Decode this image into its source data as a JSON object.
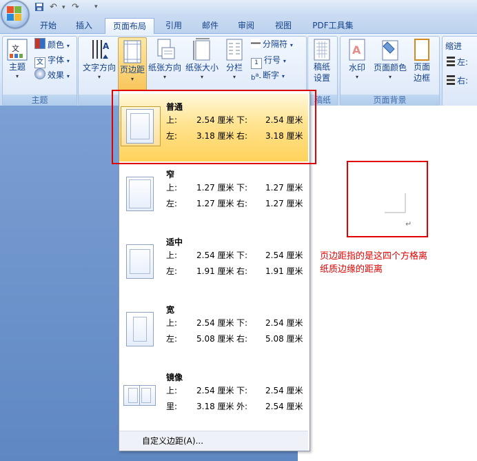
{
  "window": {
    "tabs": [
      {
        "label": "开始"
      },
      {
        "label": "插入"
      },
      {
        "label": "页面布局"
      },
      {
        "label": "引用"
      },
      {
        "label": "邮件"
      },
      {
        "label": "审阅"
      },
      {
        "label": "视图"
      },
      {
        "label": "PDF工具集"
      }
    ],
    "active_tab": "页面布局"
  },
  "ribbon": {
    "theme_group": {
      "label": "主题",
      "themes_button": "主题",
      "colors": "颜色",
      "fonts": "字体",
      "effects": "效果"
    },
    "page_setup_group": {
      "text_direction": "文字方向",
      "margins": "页边距",
      "orientation": "纸张方向",
      "size": "纸张大小",
      "columns": "分栏",
      "breaks": "分隔符",
      "line_numbers": "行号",
      "hyphenation": "断字"
    },
    "manuscript_group": {
      "label": "稿纸",
      "button": "稿纸设置"
    },
    "background_group": {
      "label": "页面背景",
      "watermark": "水印",
      "page_color": "页面颜色",
      "page_borders": "页面边框"
    },
    "paragraph_group": {
      "indent_title": "缩进",
      "left": "左:",
      "right": "右:"
    }
  },
  "margins_menu": {
    "presets": [
      {
        "name": "普通",
        "label1": "上:",
        "value1": "2.54 厘米",
        "label2": "下:",
        "value2": "2.54 厘米",
        "label3": "左:",
        "value3": "3.18 厘米",
        "label4": "右:",
        "value4": "3.18 厘米"
      },
      {
        "name": "窄",
        "label1": "上:",
        "value1": "1.27 厘米",
        "label2": "下:",
        "value2": "1.27 厘米",
        "label3": "左:",
        "value3": "1.27 厘米",
        "label4": "右:",
        "value4": "1.27 厘米"
      },
      {
        "name": "适中",
        "label1": "上:",
        "value1": "2.54 厘米",
        "label2": "下:",
        "value2": "2.54 厘米",
        "label3": "左:",
        "value3": "1.91 厘米",
        "label4": "右:",
        "value4": "1.91 厘米"
      },
      {
        "name": "宽",
        "label1": "上:",
        "value1": "2.54 厘米",
        "label2": "下:",
        "value2": "2.54 厘米",
        "label3": "左:",
        "value3": "5.08 厘米",
        "label4": "右:",
        "value4": "5.08 厘米"
      },
      {
        "name": "镜像",
        "label1": "上:",
        "value1": "2.54 厘米",
        "label2": "下:",
        "value2": "2.54 厘米",
        "label3": "里:",
        "value3": "3.18 厘米",
        "label4": "外:",
        "value4": "2.54 厘米"
      }
    ],
    "selected": "普通",
    "custom": "自定义边距(A)..."
  },
  "annotation": {
    "text_line1": "页边距指的是这四个方格离",
    "text_line2": "纸质边缘的距离",
    "paragraph_mark": "↵",
    "color": "#e00000"
  },
  "colors": {
    "ribbon": "#dbe8f8",
    "highlight": "#ffd25b",
    "document_bg": "#6b8fc9"
  }
}
